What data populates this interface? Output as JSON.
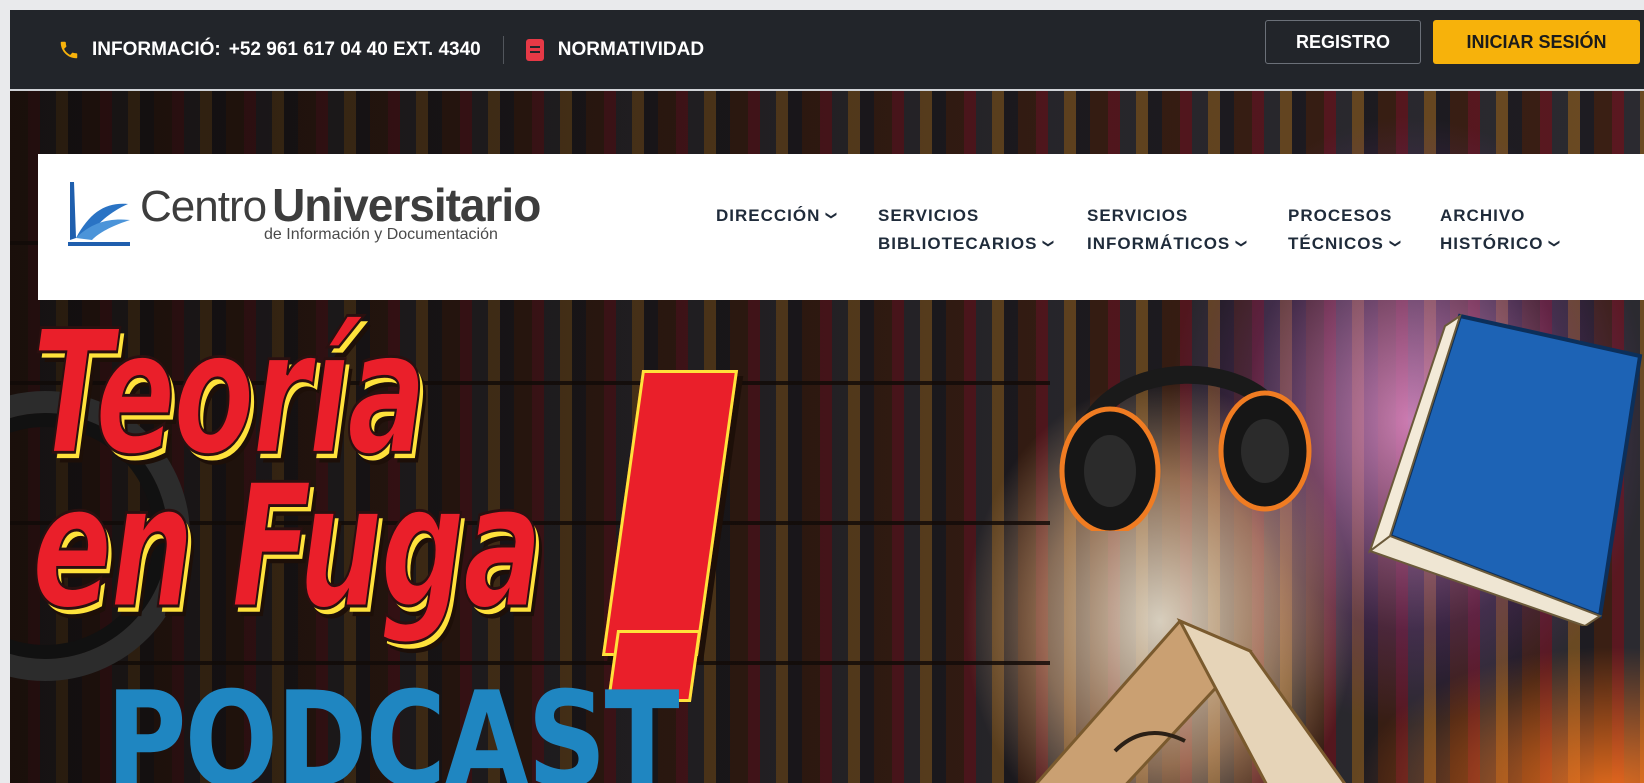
{
  "topbar": {
    "phone_label": "INFORMACIÓ:",
    "phone_number": "+52 961 617 04 40 EXT. 4340",
    "normatividad": "NORMATIVIDAD",
    "registro": "REGISTRO",
    "login": "INICIAR SESIÓN",
    "accent_color": "#f7b20b"
  },
  "logo": {
    "word1": "Centro",
    "word2": "Universitario",
    "subtitle": "de Información y Documentación"
  },
  "nav": [
    {
      "line1": "DIRECCIÓN",
      "line2": ""
    },
    {
      "line1": "SERVICIOS",
      "line2": "BIBLIOTECARIOS"
    },
    {
      "line1": "SERVICIOS",
      "line2": "INFORMÁTICOS"
    },
    {
      "line1": "PROCESOS",
      "line2": "TÉCNICOS"
    },
    {
      "line1": "ARCHIVO",
      "line2": "HISTÓRICO"
    }
  ],
  "hero": {
    "title_line1": "Teoría",
    "title_line2": "en Fuga",
    "subtitle": "PODCAST"
  }
}
